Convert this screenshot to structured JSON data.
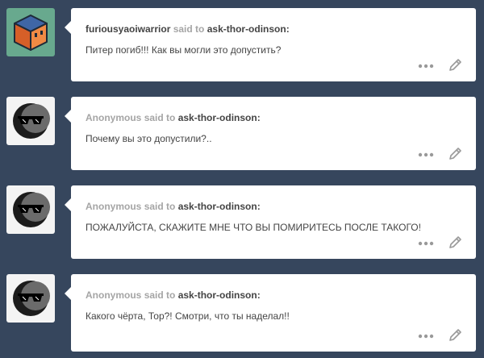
{
  "asks": [
    {
      "avatar": "cube-avatar",
      "asker": "furiousyaoiwarrior",
      "asker_is_link": true,
      "said_to": "said to",
      "recipient": "ask-thor-odinson:",
      "question": "Питер погиб!!! Как вы могли это допустить?"
    },
    {
      "avatar": "anonymous-sunglasses-avatar",
      "asker": "Anonymous",
      "asker_is_link": false,
      "said_to": "said to",
      "recipient": "ask-thor-odinson:",
      "question": "Почему вы это допустили?.."
    },
    {
      "avatar": "anonymous-sunglasses-avatar",
      "asker": "Anonymous",
      "asker_is_link": false,
      "said_to": "said to",
      "recipient": "ask-thor-odinson:",
      "question": "ПОЖАЛУЙСТА, СКАЖИТЕ МНЕ ЧТО ВЫ ПОМИРИТЕСЬ ПОСЛЕ ТАКОГО!"
    },
    {
      "avatar": "anonymous-sunglasses-avatar",
      "asker": "Anonymous",
      "asker_is_link": false,
      "said_to": "said to",
      "recipient": "ask-thor-odinson:",
      "question": "Какого чёрта, Тор?! Смотри, что ты наделал!!"
    }
  ],
  "icons": {
    "more": "more-dots-icon",
    "edit": "pencil-icon"
  },
  "colors": {
    "background": "#36465d",
    "card": "#ffffff",
    "cube_avatar_bg": "#68a98e",
    "cube_orange": "#e8763a",
    "cube_blue": "#3f66a6",
    "anon_avatar_bg": "#f4f4f4"
  }
}
